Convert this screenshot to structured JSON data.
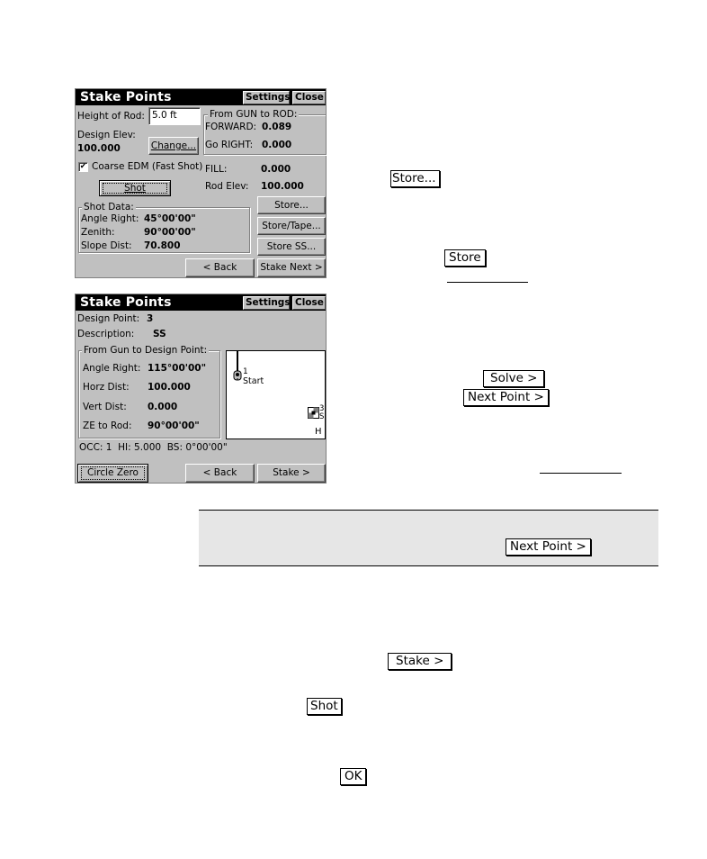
{
  "dialog1": {
    "title": "Stake Points",
    "settings_label": "Settings",
    "close_label": "Close",
    "height_of_rod_label": "Height of Rod:",
    "height_of_rod_value": "5.0 ft",
    "design_elev_label": "Design Elev:",
    "design_elev_value": "100.000",
    "change_label": "Change...",
    "gun_to_rod": {
      "legend": "From GUN to ROD:",
      "forward_label": "FORWARD:",
      "forward_value": "0.089",
      "go_right_label": "Go RIGHT:",
      "go_right_value": "0.000"
    },
    "coarse_edm_label": "Coarse EDM (Fast Shot)",
    "coarse_edm_checked": true,
    "fill_label": "FILL:",
    "fill_value": "0.000",
    "rod_elev_label": "Rod Elev:",
    "rod_elev_value": "100.000",
    "shot_label": "Shot",
    "shot_data": {
      "legend": "Shot Data:",
      "angle_right_label": "Angle Right:",
      "angle_right_value": "45°00'00\"",
      "zenith_label": "Zenith:",
      "zenith_value": "90°00'00\"",
      "slope_dist_label": "Slope Dist:",
      "slope_dist_value": "70.800"
    },
    "store_label": "Store...",
    "store_tape_label": "Store/Tape...",
    "store_ss_label": "Store SS...",
    "back_label": "< Back",
    "stake_next_label": "Stake Next >"
  },
  "dialog2": {
    "title": "Stake Points",
    "settings_label": "Settings",
    "close_label": "Close",
    "design_point_label": "Design Point:",
    "design_point_value": "3",
    "description_label": "Description:",
    "description_value": "SS",
    "gun_to_design": {
      "legend": "From Gun to Design Point:",
      "angle_right_label": "Angle Right:",
      "angle_right_value": "115°00'00\"",
      "horz_dist_label": "Horz Dist:",
      "horz_dist_value": "100.000",
      "vert_dist_label": "Vert Dist:",
      "vert_dist_value": "0.000",
      "ze_to_rod_label": "ZE to Rod:",
      "ze_to_rod_value": "90°00'00\""
    },
    "map": {
      "start_point_number": "1",
      "start_point_label": "Start",
      "target_point_number": "3",
      "target_point_desc": "S",
      "view_mode": "H"
    },
    "status": "OCC: 1  HI: 5.000  BS: 0°00'00\"",
    "circle_zero_label": "Circle Zero",
    "back_label": "< Back",
    "stake_label": "Stake >"
  },
  "inline_buttons": {
    "store_ellipsis": "Store...",
    "store": "Store",
    "solve": "Solve >",
    "next_point": "Next Point >",
    "note_next_point": "Next Point >",
    "stake": "Stake >",
    "shot": "Shot",
    "ok": "OK"
  }
}
